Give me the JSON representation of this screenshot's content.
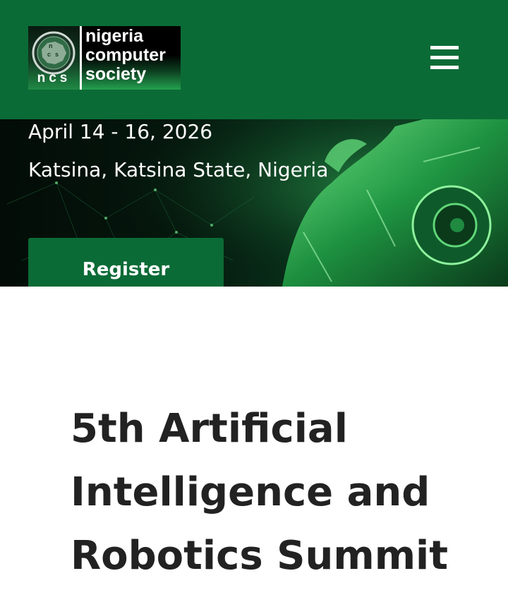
{
  "header": {
    "logo": {
      "emblem_letters": "n c s",
      "badge": "ncs",
      "name_lines": [
        "nigeria",
        "computer",
        "society"
      ]
    },
    "menu_icon": "hamburger-menu-icon"
  },
  "hero": {
    "date": "April 14 - 16, 2026",
    "location": "Katsina, Katsina State, Nigeria",
    "register_label": "Register"
  },
  "main": {
    "title": "5th Artificial Intelligence and Robotics Summit"
  },
  "colors": {
    "brand_green": "#0b6b36",
    "title_text": "#222222",
    "white": "#ffffff"
  }
}
